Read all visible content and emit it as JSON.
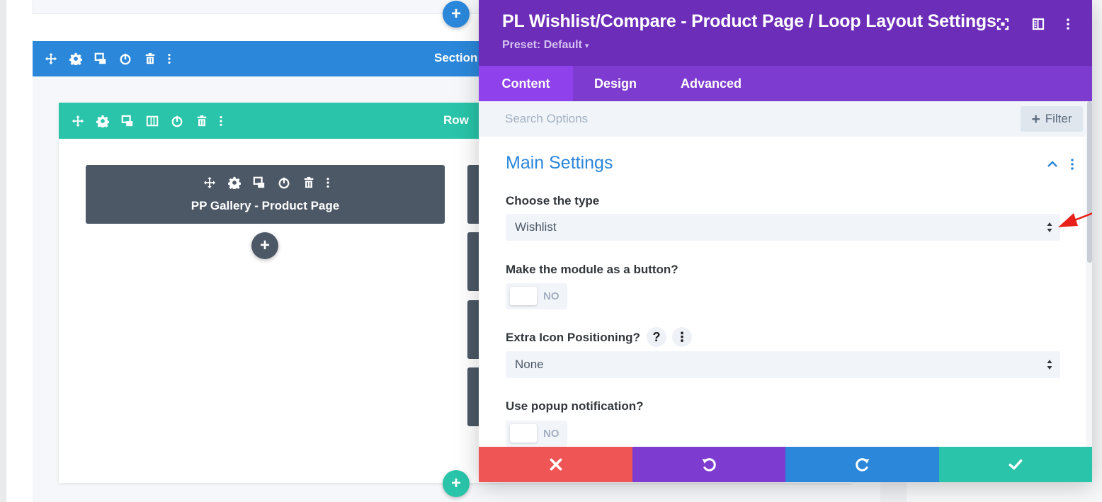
{
  "builder": {
    "section_label": "Section",
    "row_label": "Row",
    "module_title": "PP Gallery - Product Page",
    "add_glyph": "+",
    "colors": {
      "section": "#2b87da",
      "row": "#29c4a9",
      "module": "#4c5866"
    },
    "section_controls": [
      "move-icon",
      "gear-icon",
      "duplicate-icon",
      "power-icon",
      "trash-icon",
      "more-vertical-icon"
    ],
    "row_controls": [
      "move-icon",
      "gear-icon",
      "duplicate-icon",
      "columns-icon",
      "power-icon",
      "trash-icon",
      "more-vertical-icon"
    ],
    "module_controls": [
      "move-icon",
      "gear-icon",
      "duplicate-icon",
      "power-icon",
      "trash-icon",
      "more-vertical-icon"
    ]
  },
  "modal": {
    "title": "PL Wishlist/Compare - Product Page / Loop Layout Settings",
    "preset": "Preset: Default",
    "preset_caret": "▾",
    "header_icons": [
      "expand-icon",
      "sidebar-toggle-icon",
      "more-vertical-icon"
    ],
    "tabs": [
      {
        "label": "Content",
        "active": true
      },
      {
        "label": "Design",
        "active": false
      },
      {
        "label": "Advanced",
        "active": false
      }
    ],
    "search": {
      "placeholder": "Search Options",
      "value": ""
    },
    "filter": {
      "label": "Filter",
      "plus": "+"
    },
    "group": {
      "title": "Main Settings",
      "expanded": true
    },
    "fields": {
      "type": {
        "label": "Choose the type",
        "value": "Wishlist"
      },
      "as_button": {
        "label": "Make the module as a button?",
        "toggle_text": "NO"
      },
      "icon_pos": {
        "label": "Extra Icon Positioning?",
        "value": "None",
        "help_glyph": "?",
        "more_glyph": "⋮"
      },
      "popup": {
        "label": "Use popup notification?",
        "toggle_text": "NO"
      }
    },
    "footer": [
      "close-icon",
      "undo-icon",
      "redo-icon",
      "check-icon"
    ],
    "colors": {
      "header": "#6c2eb9",
      "tabs": "#7e3bd0",
      "tab_active": "#8f42ec",
      "accent": "#2b87da",
      "discard": "#ef5555",
      "undo": "#7e3bd0",
      "redo": "#2b87da",
      "save": "#29c4a9",
      "annotation": "#e8201a"
    }
  }
}
